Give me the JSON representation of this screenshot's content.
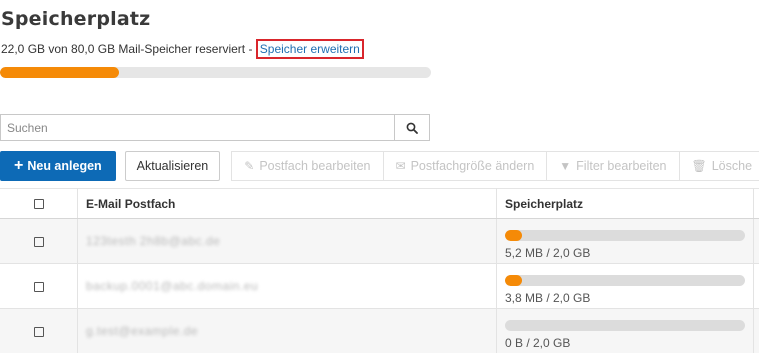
{
  "page": {
    "title": "Speicherplatz",
    "quota_text": "22,0 GB von 80,0 GB Mail-Speicher reserviert - ",
    "quota_link": "Speicher erweitern",
    "quota_fraction": 0.275
  },
  "search": {
    "placeholder": "Suchen",
    "button_icon": "search-icon"
  },
  "toolbar": {
    "new_label": "Neu anlegen",
    "refresh_label": "Aktualisieren",
    "edit_mailbox_label": "Postfach bearbeiten",
    "resize_mailbox_label": "Postfachgröße ändern",
    "edit_filter_label": "Filter bearbeiten",
    "delete_label": "Lösche"
  },
  "table": {
    "columns": [
      "",
      "E-Mail Postfach",
      "Speicherplatz"
    ],
    "rows": [
      {
        "email": "123testh 2h8b@abc.de",
        "usage": "5,2 MB / 2,0 GB",
        "fraction": 0.07
      },
      {
        "email": "backup.0001@abc.domain.eu",
        "usage": "3,8 MB / 2,0 GB",
        "fraction": 0.07
      },
      {
        "email": "g.test@example.de",
        "usage": "0 B / 2,0 GB",
        "fraction": 0
      }
    ]
  },
  "colors": {
    "accent": "#f58a07",
    "primary_button": "#0d6ab6",
    "link": "#1f6fb2",
    "highlight_border": "#d9262c"
  }
}
